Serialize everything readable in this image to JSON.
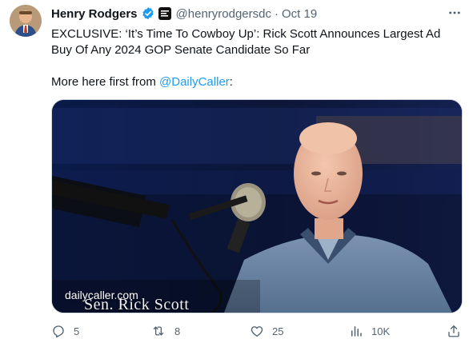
{
  "tweet": {
    "author": {
      "display_name": "Henry Rodgers",
      "handle": "@henryrodgersdc",
      "verified_badge": "blue-check-icon",
      "affiliate_badge": "daily-caller-badge-icon"
    },
    "separator": "·",
    "date": "Oct 19",
    "more_icon": "more-horizontal-icon",
    "text_line1": "EXCLUSIVE: ‘It’s Time To Cowboy Up’: Rick Scott Announces Largest Ad Buy Of Any 2024 GOP Senate Candidate So Far",
    "text_line2_prefix": "More here first from ",
    "text_line2_mention": "@DailyCaller",
    "text_line2_suffix": ":",
    "media": {
      "watermark": "dailycaller.com",
      "caption": "Sen. Rick Scott"
    },
    "actions": {
      "reply": {
        "icon": "reply-icon",
        "count": "5"
      },
      "retweet": {
        "icon": "retweet-icon",
        "count": "8"
      },
      "like": {
        "icon": "heart-icon",
        "count": "25"
      },
      "views": {
        "icon": "views-icon",
        "count": "10K"
      },
      "share": {
        "icon": "share-icon"
      }
    },
    "colors": {
      "link": "#1d9bf0",
      "text": "#0f1419",
      "muted": "#536471"
    }
  }
}
